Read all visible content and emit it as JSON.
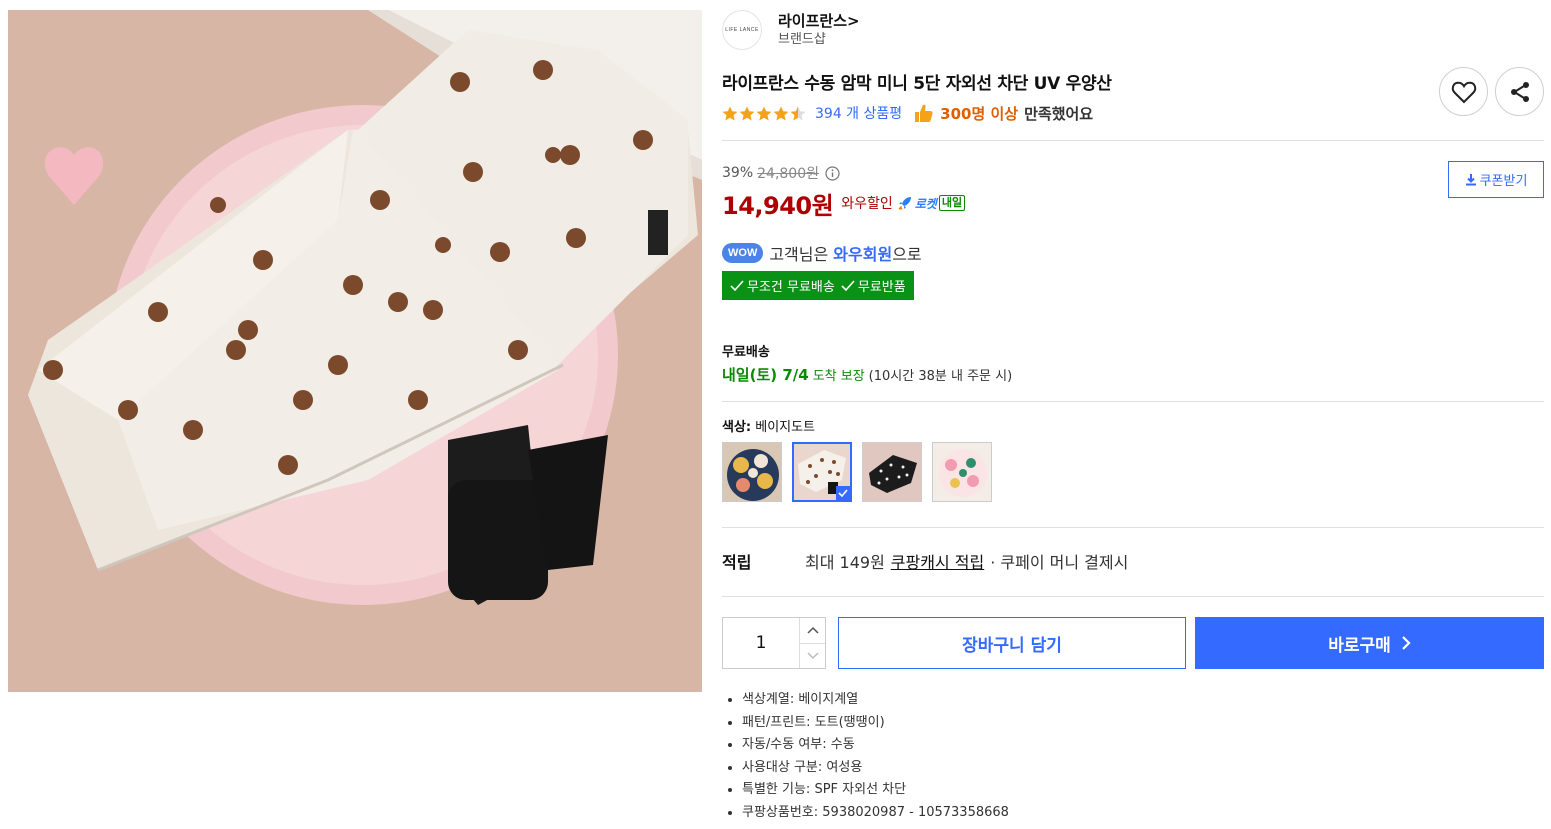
{
  "brand": {
    "logo_text": "LIFE LANCE",
    "name": "라이프란스>",
    "sub": "브랜드샵"
  },
  "product": {
    "title": "라이프란스 수동 암막 미니 5단 자외선 차단 UV 우양산",
    "rating": 4.5,
    "review_count": "394 개 상품평",
    "satisfaction_count": "300명 이상",
    "satisfaction_text": "만족했어요"
  },
  "price": {
    "discount_rate": "39%",
    "original_price": "24,800원",
    "sale_price": "14,940원",
    "wow_discount_label": "와우할인",
    "rocket_label": "로켓",
    "rocket_tag": "내일",
    "coupon_label": "쿠폰받기"
  },
  "wow": {
    "badge": "WOW",
    "text_prefix": "고객님은 ",
    "member": "와우회원",
    "text_suffix": "으로"
  },
  "benefits": [
    "무조건 무료배송",
    "무료반품"
  ],
  "shipping": {
    "label": "무료배송",
    "arrival": "내일(토) 7/4",
    "guarantee": "도착 보장",
    "deadline": "(10시간 38분 내 주문 시)"
  },
  "color_option": {
    "label": "색상:",
    "selected": "베이지도트",
    "swatches": [
      "floral-navy",
      "beige-dot",
      "black-dot",
      "pink-pattern"
    ],
    "selected_index": 1
  },
  "points": {
    "label": "적립",
    "text_before": "최대 149원",
    "link": "쿠팡캐시 적립",
    "text_after": "· 쿠페이 머니 결제시"
  },
  "purchase": {
    "quantity": "1",
    "cart_label": "장바구니 담기",
    "buy_label": "바로구매"
  },
  "specs": [
    "색상계열: 베이지계열",
    "패턴/프린트: 도트(땡땡이)",
    "자동/수동 여부: 수동",
    "사용대상 구분: 여성용",
    "특별한 기능: SPF 자외선 차단",
    "쿠팡상품번호: 5938020987 - 10573358668"
  ],
  "colors": {
    "accent": "#346aff",
    "price_red": "#ae0000",
    "green": "#0a8a00",
    "orange": "#e05f00"
  }
}
